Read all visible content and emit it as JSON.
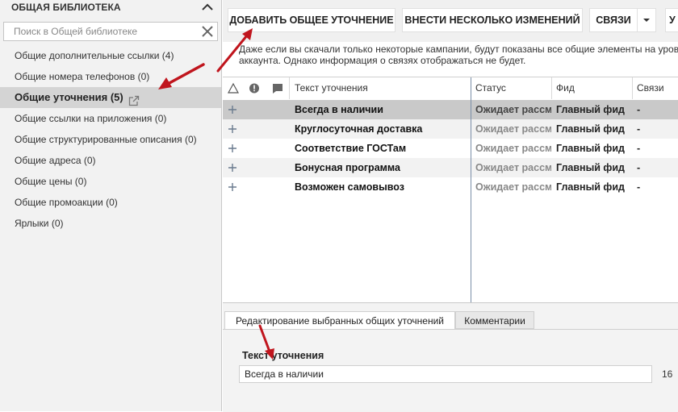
{
  "sidebar": {
    "title": "ОБЩАЯ БИБЛИОТЕКА",
    "search_placeholder": "Поиск в Общей библиотеке",
    "items": [
      {
        "label": "Общие дополнительные ссылки (4)"
      },
      {
        "label": "Общие номера телефонов (0)"
      },
      {
        "label": "Общие уточнения (5)",
        "active": true
      },
      {
        "label": "Общие ссылки на приложения (0)"
      },
      {
        "label": "Общие структурированные описания (0)"
      },
      {
        "label": "Общие адреса (0)"
      },
      {
        "label": "Общие цены (0)"
      },
      {
        "label": "Общие промоакции (0)"
      },
      {
        "label": "Ярлыки (0)"
      }
    ]
  },
  "toolbar": {
    "add_label": "ДОБАВИТЬ ОБЩЕЕ УТОЧНЕНИЕ",
    "bulk_label": "ВНЕСТИ НЕСКОЛЬКО ИЗМЕНЕНИЙ",
    "links_label": "СВЯЗИ",
    "more_label": "У"
  },
  "notice": "Даже если вы скачали только некоторые кампании, будут показаны все общие элементы на уровне аккаунта. Однако информация о связях отображаться не будет.",
  "table": {
    "headers": {
      "text": "Текст уточнения",
      "status": "Статус",
      "feed": "Фид",
      "links": "Связи"
    },
    "rows": [
      {
        "text": "Всегда в наличии",
        "status": "Ожидает рассмотрения",
        "feed": "Главный фид",
        "links": "-",
        "selected": true
      },
      {
        "text": "Круглосуточная доставка",
        "status": "Ожидает рассмотрения",
        "feed": "Главный фид",
        "links": "-"
      },
      {
        "text": "Соответствие ГОСТам",
        "status": "Ожидает рассмотрения",
        "feed": "Главный фид",
        "links": "-"
      },
      {
        "text": "Бонусная программа",
        "status": "Ожидает рассмотрения",
        "feed": "Главный фид",
        "links": "-"
      },
      {
        "text": "Возможен самовывоз",
        "status": "Ожидает рассмотрения",
        "feed": "Главный фид",
        "links": "-"
      }
    ]
  },
  "bottom": {
    "tab_edit": "Редактирование выбранных общих уточнений",
    "tab_comments": "Комментарии",
    "field_label": "Текст уточнения",
    "field_value": "Всегда в наличии",
    "char_count": "16"
  },
  "colors": {
    "annotation_arrow": "#c0151d",
    "selected_row": "#c9c9c9",
    "sidebar_bg": "#f2f2f2"
  },
  "icons": [
    "chevron-up-icon",
    "clear-x-icon",
    "external-link-icon",
    "warning-triangle-icon",
    "error-circle-icon",
    "comment-icon",
    "plus-icon",
    "dropdown-caret-icon"
  ]
}
